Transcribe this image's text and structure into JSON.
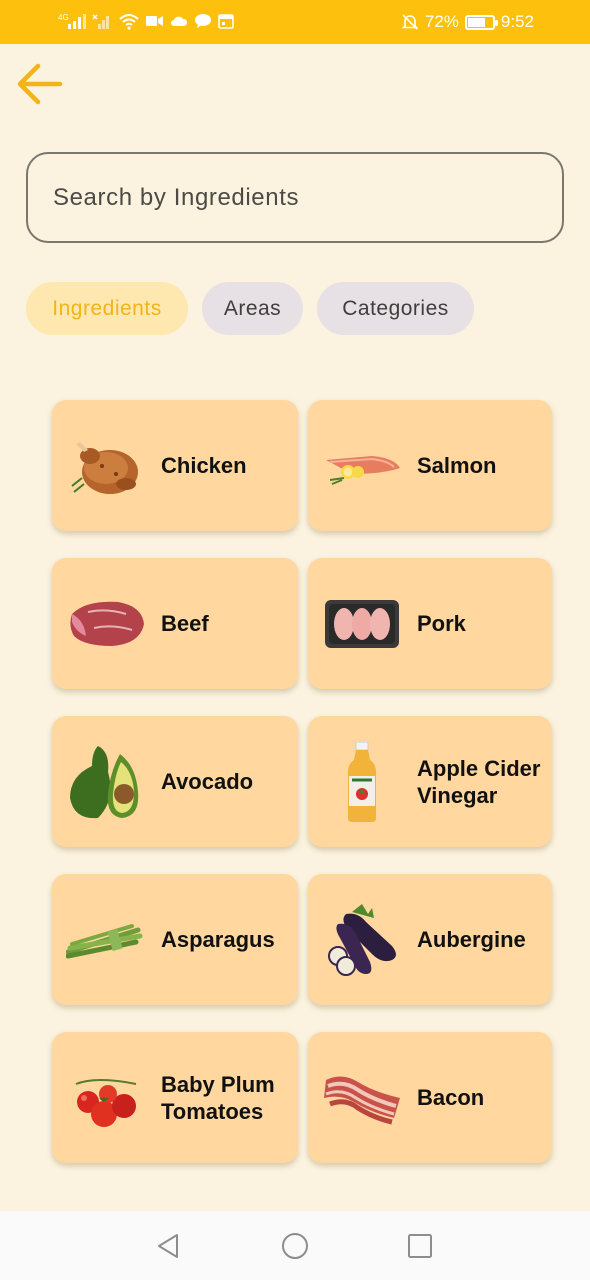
{
  "status_bar": {
    "network": "4G",
    "battery_percent": "72%",
    "battery_level": 0.72,
    "time": "9:52",
    "icons": [
      "signal-icon",
      "signal-icon-2",
      "wifi-icon",
      "video-icon",
      "cloud-icon",
      "chat-icon",
      "calendar-icon",
      "mute-bell-icon",
      "battery-icon"
    ]
  },
  "header": {
    "back_icon": "arrow-left-icon",
    "accent_color": "#F2B418"
  },
  "search": {
    "placeholder": "Search by Ingredients",
    "value": ""
  },
  "filters": {
    "chips": [
      {
        "label": "Ingredients",
        "active": true
      },
      {
        "label": "Areas",
        "active": false
      },
      {
        "label": "Categories",
        "active": false
      }
    ]
  },
  "ingredients": [
    {
      "name": "Chicken",
      "icon": "chicken-image"
    },
    {
      "name": "Salmon",
      "icon": "salmon-image"
    },
    {
      "name": "Beef",
      "icon": "beef-image"
    },
    {
      "name": "Pork",
      "icon": "pork-image"
    },
    {
      "name": "Avocado",
      "icon": "avocado-image"
    },
    {
      "name": "Apple Cider Vinegar",
      "icon": "vinegar-bottle-image"
    },
    {
      "name": "Asparagus",
      "icon": "asparagus-image"
    },
    {
      "name": "Aubergine",
      "icon": "aubergine-image"
    },
    {
      "name": "Baby Plum Tomatoes",
      "icon": "tomatoes-image"
    },
    {
      "name": "Bacon",
      "icon": "bacon-image"
    }
  ],
  "nav_bar": {
    "icons": [
      "back-triangle-icon",
      "home-circle-icon",
      "recents-square-icon"
    ]
  }
}
